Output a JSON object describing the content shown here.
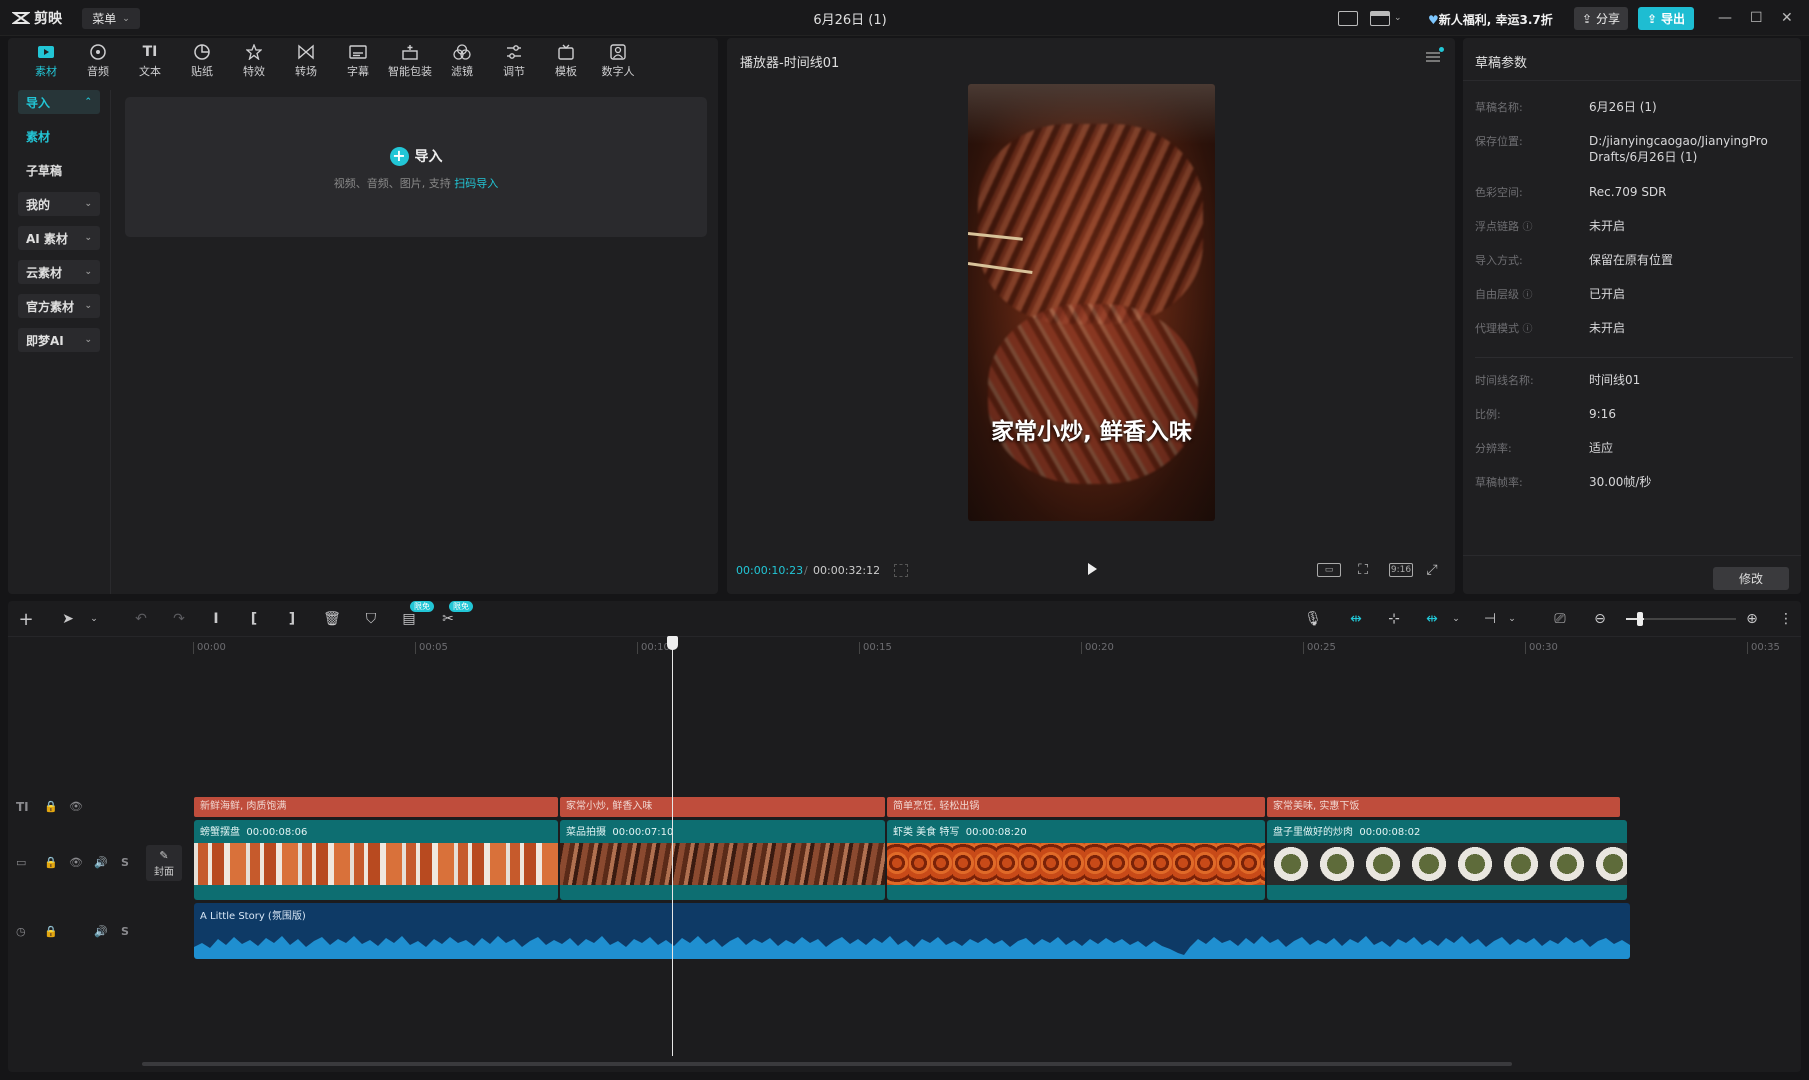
{
  "app": {
    "name": "剪映",
    "menu_label": "菜单",
    "title": "6月26日 (1)",
    "promo": "新人福利, 幸运3.7折",
    "share_label": "分享",
    "export_label": "导出"
  },
  "toolbar": {
    "items": [
      {
        "label": "素材",
        "icon": "media-icon"
      },
      {
        "label": "音频",
        "icon": "audio-icon"
      },
      {
        "label": "文本",
        "icon": "text-icon"
      },
      {
        "label": "贴纸",
        "icon": "sticker-icon"
      },
      {
        "label": "特效",
        "icon": "effects-icon"
      },
      {
        "label": "转场",
        "icon": "transition-icon"
      },
      {
        "label": "字幕",
        "icon": "subtitle-icon"
      },
      {
        "label": "智能包装",
        "icon": "smart-pack-icon"
      },
      {
        "label": "滤镜",
        "icon": "filter-icon"
      },
      {
        "label": "调节",
        "icon": "adjust-icon"
      },
      {
        "label": "模板",
        "icon": "template-icon"
      },
      {
        "label": "数字人",
        "icon": "digital-human-icon"
      }
    ]
  },
  "sidebar": {
    "items": [
      {
        "label": "导入"
      },
      {
        "label": "素材"
      },
      {
        "label": "子草稿"
      },
      {
        "label": "我的"
      },
      {
        "label": "AI 素材"
      },
      {
        "label": "云素材"
      },
      {
        "label": "官方素材"
      },
      {
        "label": "即梦AI"
      }
    ]
  },
  "import": {
    "title": "导入",
    "subtitle": "视频、音频、图片, 支持",
    "link": "扫码导入"
  },
  "player": {
    "title": "播放器-时间线01",
    "subtitle_text": "家常小炒, 鲜香入味",
    "current_time": "00:00:10:23",
    "total_time": "00:00:32:12",
    "ratio_label": "9:16"
  },
  "props": {
    "title": "草稿参数",
    "rows": [
      {
        "k": "草稿名称:",
        "v": "6月26日 (1)"
      },
      {
        "k": "保存位置:",
        "v": "D:/jianyingcaogao/JianyingPro Drafts/6月26日 (1)"
      },
      {
        "k": "色彩空间:",
        "v": "Rec.709 SDR"
      },
      {
        "k": "浮点链路",
        "v": "未开启"
      },
      {
        "k": "导入方式:",
        "v": "保留在原有位置"
      },
      {
        "k": "自由层级",
        "v": "已开启"
      },
      {
        "k": "代理模式",
        "v": "未开启"
      },
      {
        "k": "时间线名称:",
        "v": "时间线01"
      },
      {
        "k": "比例:",
        "v": "9:16"
      },
      {
        "k": "分辨率:",
        "v": "适应"
      },
      {
        "k": "草稿帧率:",
        "v": "30.00帧/秒"
      }
    ],
    "modify_label": "修改"
  },
  "timeline": {
    "free_badge": "限免",
    "ruler": [
      "00:00",
      "00:05",
      "00:10",
      "00:15",
      "00:20",
      "00:25",
      "00:30",
      "00:35"
    ],
    "cover_label": "封面",
    "text_clips": [
      {
        "label": "新鲜海鲜, 肉质饱满"
      },
      {
        "label": "家常小炒, 鲜香入味"
      },
      {
        "label": "简单烹饪, 轻松出锅"
      },
      {
        "label": "家常美味, 实惠下饭"
      }
    ],
    "video_clips": [
      {
        "name": "螃蟹摆盘",
        "duration": "00:00:08:06"
      },
      {
        "name": "菜品拍摄",
        "duration": "00:00:07:10"
      },
      {
        "name": "虾类 美食 特写",
        "duration": "00:00:08:20"
      },
      {
        "name": "盘子里做好的炒肉",
        "duration": "00:00:08:02"
      }
    ],
    "audio_clip": {
      "name": "A Little Story (氛围版)"
    }
  },
  "colors": {
    "accent": "#22c6d6",
    "text_clip": "#bf4d3c",
    "video_clip": "#0d6e71",
    "audio_clip": "#0e3a66"
  }
}
